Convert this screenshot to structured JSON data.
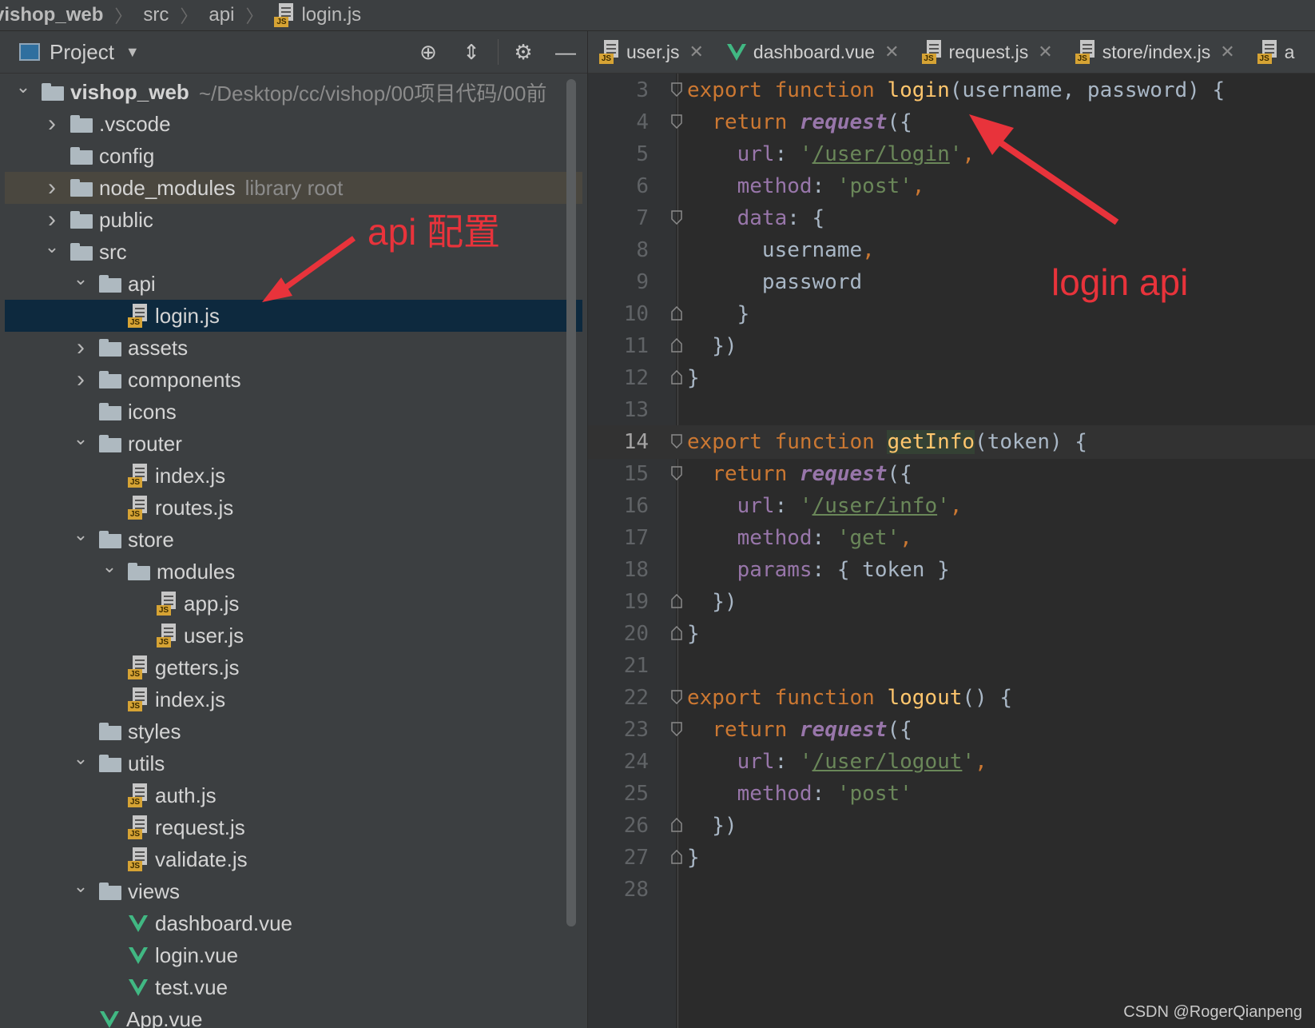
{
  "breadcrumb": [
    "vishop_web",
    "src",
    "api",
    "login.js"
  ],
  "project_panel": {
    "title": "Project",
    "tree": [
      {
        "label": "vishop_web",
        "hint": "~/Desktop/cc/vishop/00项目代码/00前",
        "type": "folder",
        "depth": 0,
        "state": "open",
        "bold": true
      },
      {
        "label": ".vscode",
        "type": "folder",
        "depth": 1,
        "state": "closed"
      },
      {
        "label": "config",
        "type": "folder",
        "depth": 1,
        "state": "none"
      },
      {
        "label": "node_modules",
        "hint": "library root",
        "type": "folder",
        "depth": 1,
        "state": "closed",
        "libroot": true
      },
      {
        "label": "public",
        "type": "folder",
        "depth": 1,
        "state": "closed"
      },
      {
        "label": "src",
        "type": "folder",
        "depth": 1,
        "state": "open"
      },
      {
        "label": "api",
        "type": "folder",
        "depth": 2,
        "state": "open"
      },
      {
        "label": "login.js",
        "type": "js",
        "depth": 3,
        "selected": true
      },
      {
        "label": "assets",
        "type": "folder",
        "depth": 2,
        "state": "closed"
      },
      {
        "label": "components",
        "type": "folder",
        "depth": 2,
        "state": "closed"
      },
      {
        "label": "icons",
        "type": "folder",
        "depth": 2,
        "state": "none"
      },
      {
        "label": "router",
        "type": "folder",
        "depth": 2,
        "state": "open"
      },
      {
        "label": "index.js",
        "type": "js",
        "depth": 3
      },
      {
        "label": "routes.js",
        "type": "js",
        "depth": 3
      },
      {
        "label": "store",
        "type": "folder",
        "depth": 2,
        "state": "open"
      },
      {
        "label": "modules",
        "type": "folder",
        "depth": 3,
        "state": "open"
      },
      {
        "label": "app.js",
        "type": "js",
        "depth": 4
      },
      {
        "label": "user.js",
        "type": "js",
        "depth": 4
      },
      {
        "label": "getters.js",
        "type": "js",
        "depth": 3
      },
      {
        "label": "index.js",
        "type": "js",
        "depth": 3
      },
      {
        "label": "styles",
        "type": "folder",
        "depth": 2,
        "state": "none"
      },
      {
        "label": "utils",
        "type": "folder",
        "depth": 2,
        "state": "open"
      },
      {
        "label": "auth.js",
        "type": "js",
        "depth": 3
      },
      {
        "label": "request.js",
        "type": "js",
        "depth": 3
      },
      {
        "label": "validate.js",
        "type": "js",
        "depth": 3
      },
      {
        "label": "views",
        "type": "folder",
        "depth": 2,
        "state": "open"
      },
      {
        "label": "dashboard.vue",
        "type": "vue",
        "depth": 3
      },
      {
        "label": "login.vue",
        "type": "vue",
        "depth": 3
      },
      {
        "label": "test.vue",
        "type": "vue",
        "depth": 3
      },
      {
        "label": "App.vue",
        "type": "vue",
        "depth": 2
      }
    ]
  },
  "tabs": [
    {
      "label": "user.js",
      "type": "js"
    },
    {
      "label": "dashboard.vue",
      "type": "vue"
    },
    {
      "label": "request.js",
      "type": "js"
    },
    {
      "label": "store/index.js",
      "type": "js"
    },
    {
      "label": "a",
      "type": "js"
    }
  ],
  "code": [
    {
      "n": "3",
      "fold": "start",
      "tokens": [
        [
          "kw",
          "export "
        ],
        [
          "kw",
          "function "
        ],
        [
          "fn",
          "login"
        ],
        [
          "plain",
          "(username, password) {"
        ]
      ]
    },
    {
      "n": "4",
      "fold": "start",
      "tokens": [
        [
          "plain",
          "  "
        ],
        [
          "kw",
          "return "
        ],
        [
          "req",
          "request"
        ],
        [
          "plain",
          "({"
        ]
      ]
    },
    {
      "n": "5",
      "tokens": [
        [
          "plain",
          "    "
        ],
        [
          "prop",
          "url"
        ],
        [
          "plain",
          ": "
        ],
        [
          "str",
          "'"
        ],
        [
          "url",
          "/user/login"
        ],
        [
          "str",
          "'"
        ],
        [
          "kw",
          ","
        ]
      ]
    },
    {
      "n": "6",
      "tokens": [
        [
          "plain",
          "    "
        ],
        [
          "prop",
          "method"
        ],
        [
          "plain",
          ": "
        ],
        [
          "str",
          "'post'"
        ],
        [
          "kw",
          ","
        ]
      ]
    },
    {
      "n": "7",
      "fold": "start",
      "tokens": [
        [
          "plain",
          "    "
        ],
        [
          "prop",
          "data"
        ],
        [
          "plain",
          ": {"
        ]
      ]
    },
    {
      "n": "8",
      "tokens": [
        [
          "plain",
          "      username"
        ],
        [
          "kw",
          ","
        ]
      ]
    },
    {
      "n": "9",
      "tokens": [
        [
          "plain",
          "      password"
        ]
      ]
    },
    {
      "n": "10",
      "fold": "end",
      "tokens": [
        [
          "plain",
          "    }"
        ]
      ]
    },
    {
      "n": "11",
      "fold": "end",
      "tokens": [
        [
          "plain",
          "  })"
        ]
      ]
    },
    {
      "n": "12",
      "fold": "end",
      "tokens": [
        [
          "plain",
          "}"
        ]
      ]
    },
    {
      "n": "13",
      "tokens": []
    },
    {
      "n": "14",
      "current": true,
      "fold": "start",
      "tokens": [
        [
          "kw",
          "export "
        ],
        [
          "kw",
          "function "
        ],
        [
          "fnhl",
          "getInfo"
        ],
        [
          "plain",
          "(token) {"
        ]
      ]
    },
    {
      "n": "15",
      "fold": "start",
      "tokens": [
        [
          "plain",
          "  "
        ],
        [
          "kw",
          "return "
        ],
        [
          "req",
          "request"
        ],
        [
          "plain",
          "({"
        ]
      ]
    },
    {
      "n": "16",
      "tokens": [
        [
          "plain",
          "    "
        ],
        [
          "prop",
          "url"
        ],
        [
          "plain",
          ": "
        ],
        [
          "str",
          "'"
        ],
        [
          "url",
          "/user/info"
        ],
        [
          "str",
          "'"
        ],
        [
          "kw",
          ","
        ]
      ]
    },
    {
      "n": "17",
      "tokens": [
        [
          "plain",
          "    "
        ],
        [
          "prop",
          "method"
        ],
        [
          "plain",
          ": "
        ],
        [
          "str",
          "'get'"
        ],
        [
          "kw",
          ","
        ]
      ]
    },
    {
      "n": "18",
      "tokens": [
        [
          "plain",
          "    "
        ],
        [
          "prop",
          "params"
        ],
        [
          "plain",
          ": { token }"
        ]
      ]
    },
    {
      "n": "19",
      "fold": "end",
      "tokens": [
        [
          "plain",
          "  })"
        ]
      ]
    },
    {
      "n": "20",
      "fold": "end",
      "tokens": [
        [
          "plain",
          "}"
        ]
      ]
    },
    {
      "n": "21",
      "tokens": []
    },
    {
      "n": "22",
      "fold": "start",
      "tokens": [
        [
          "kw",
          "export "
        ],
        [
          "kw",
          "function "
        ],
        [
          "fn",
          "logout"
        ],
        [
          "plain",
          "() {"
        ]
      ]
    },
    {
      "n": "23",
      "fold": "start",
      "tokens": [
        [
          "plain",
          "  "
        ],
        [
          "kw",
          "return "
        ],
        [
          "req",
          "request"
        ],
        [
          "plain",
          "({"
        ]
      ]
    },
    {
      "n": "24",
      "tokens": [
        [
          "plain",
          "    "
        ],
        [
          "prop",
          "url"
        ],
        [
          "plain",
          ": "
        ],
        [
          "str",
          "'"
        ],
        [
          "url",
          "/user/logout"
        ],
        [
          "str",
          "'"
        ],
        [
          "kw",
          ","
        ]
      ]
    },
    {
      "n": "25",
      "tokens": [
        [
          "plain",
          "    "
        ],
        [
          "prop",
          "method"
        ],
        [
          "plain",
          ": "
        ],
        [
          "str",
          "'post'"
        ]
      ]
    },
    {
      "n": "26",
      "fold": "end",
      "tokens": [
        [
          "plain",
          "  })"
        ]
      ]
    },
    {
      "n": "27",
      "fold": "end",
      "tokens": [
        [
          "plain",
          "}"
        ]
      ]
    },
    {
      "n": "28",
      "tokens": []
    }
  ],
  "annotations": {
    "api_config": "api 配置",
    "login_api": "login api",
    "color": "#e8333b"
  },
  "watermark": "CSDN @RogerQianpeng",
  "icons": {
    "project": "project-window-icon",
    "locate": "crosshair-icon",
    "collapse": "collapse-all-icon",
    "settings": "gear-icon",
    "hide": "minimize-icon"
  }
}
